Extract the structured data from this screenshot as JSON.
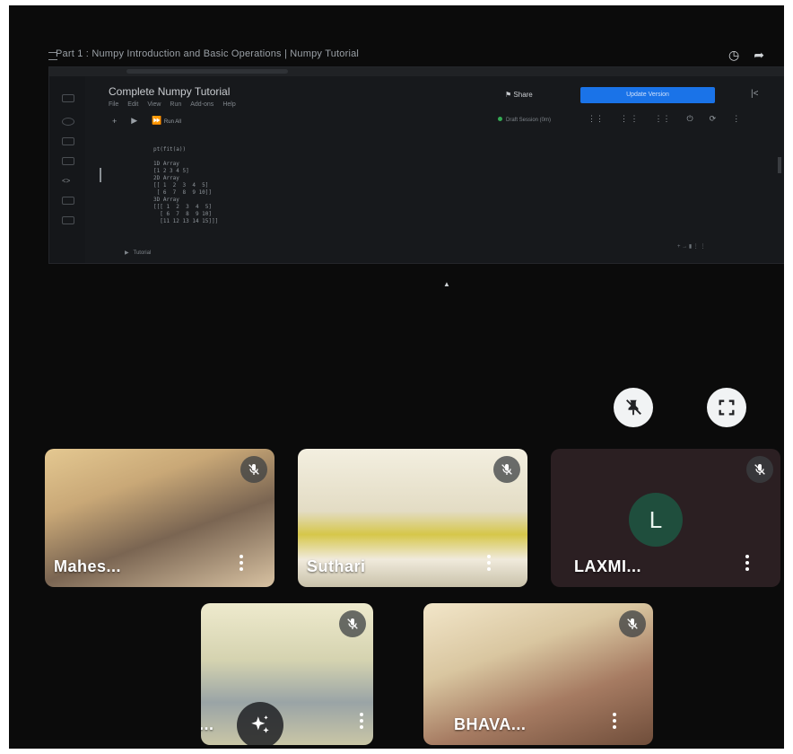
{
  "video": {
    "title": "Part 1 : Numpy Introduction and Basic Operations | Numpy Tutorial",
    "icons": [
      "clock-icon",
      "share-arrow-icon"
    ]
  },
  "notebook": {
    "title": "Complete Numpy Tutorial",
    "menu": [
      "File",
      "Edit",
      "View",
      "Run",
      "Add-ons",
      "Help"
    ],
    "share_label": "Share",
    "update_label": "Update Version",
    "run_all_label": "Run All",
    "session_label": "Draft Session (0m)",
    "code_lines": [
      "pt(fit(a))",
      "",
      "1D Array",
      "[1 2 3 4 5]",
      "2D Array",
      "[[ 1  2  3  4  5]",
      " [ 6  7  8  9 10]]",
      "3D Array",
      "[[[ 1  2  3  4  5]",
      "  [ 6  7  8  9 10]",
      "  [11 12 13 14 15]]]"
    ],
    "collapsed_cell": "Tutorial"
  },
  "participants": [
    {
      "name": "Mahes...",
      "type": "video",
      "muted": true,
      "bg": "#c9a877"
    },
    {
      "name": "Suthari",
      "type": "video",
      "muted": true,
      "bg": "#d8d2b6"
    },
    {
      "name": "LAXMI...",
      "type": "avatar",
      "initial": "L",
      "muted": true,
      "bg": "#2b1f22"
    },
    {
      "name": "...",
      "type": "video",
      "muted": true,
      "bg": "#c8c6a6"
    },
    {
      "name": "BHAVA...",
      "type": "video",
      "muted": true,
      "bg": "#a67b62"
    }
  ],
  "colors": {
    "accent": "#1a73e8",
    "tile_dark": "#2b1f22",
    "avatar": "#1f4e3d"
  }
}
